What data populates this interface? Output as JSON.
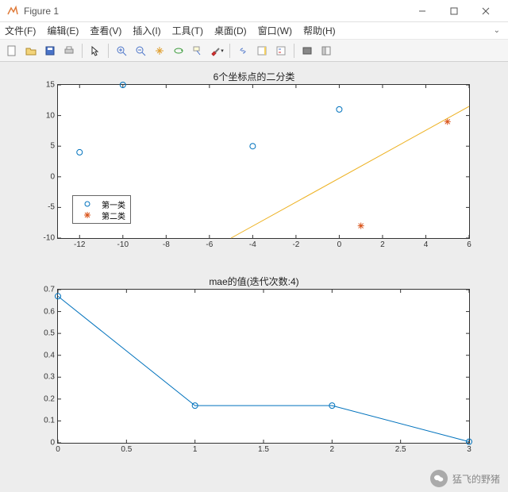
{
  "window": {
    "title": "Figure 1"
  },
  "menu": [
    "文件(F)",
    "编辑(E)",
    "查看(V)",
    "插入(I)",
    "工具(T)",
    "桌面(D)",
    "窗口(W)",
    "帮助(H)"
  ],
  "toolbar_icons": [
    "new",
    "open",
    "save",
    "print",
    "sep",
    "arrow",
    "sep",
    "zoom-in",
    "zoom-out",
    "pan",
    "rotate3d",
    "datatip",
    "brush",
    "sep",
    "link",
    "insert-colorbar",
    "insert-legend",
    "sep",
    "hide",
    "dock"
  ],
  "chart_data": [
    {
      "type": "scatter-line",
      "title": "6个坐标点的二分类",
      "xlim": [
        -13,
        6
      ],
      "ylim": [
        -10,
        15
      ],
      "xticks": [
        -12,
        -10,
        -8,
        -6,
        -4,
        -2,
        0,
        2,
        4,
        6
      ],
      "yticks": [
        -10,
        -5,
        0,
        5,
        10,
        15
      ],
      "series": [
        {
          "name": "第一类",
          "marker": "circle",
          "color": "#0072BD",
          "points": [
            [
              -12,
              4
            ],
            [
              -10,
              15
            ],
            [
              -4,
              5
            ],
            [
              0,
              11
            ]
          ]
        },
        {
          "name": "第二类",
          "marker": "star",
          "color": "#D95319",
          "points": [
            [
              1,
              -8
            ],
            [
              5,
              9
            ]
          ]
        },
        {
          "name": "boundary",
          "type": "line",
          "color": "#EDB120",
          "points": [
            [
              -5,
              -10
            ],
            [
              6,
              11.5
            ]
          ]
        }
      ],
      "legend": {
        "items": [
          "第一类",
          "第二类"
        ],
        "position": "lower-left"
      }
    },
    {
      "type": "line",
      "title": "mae的值(迭代次数:4)",
      "xlim": [
        0,
        3
      ],
      "ylim": [
        0,
        0.7
      ],
      "xticks": [
        0,
        0.5,
        1,
        1.5,
        2,
        2.5,
        3
      ],
      "yticks": [
        0,
        0.1,
        0.2,
        0.3,
        0.4,
        0.5,
        0.6,
        0.7
      ],
      "series": [
        {
          "name": "mae",
          "marker": "circle",
          "color": "#0072BD",
          "x": [
            0,
            1,
            2,
            3
          ],
          "y": [
            0.67,
            0.17,
            0.17,
            0.005
          ]
        }
      ]
    }
  ],
  "footer": {
    "text": "猛飞的野猪"
  }
}
